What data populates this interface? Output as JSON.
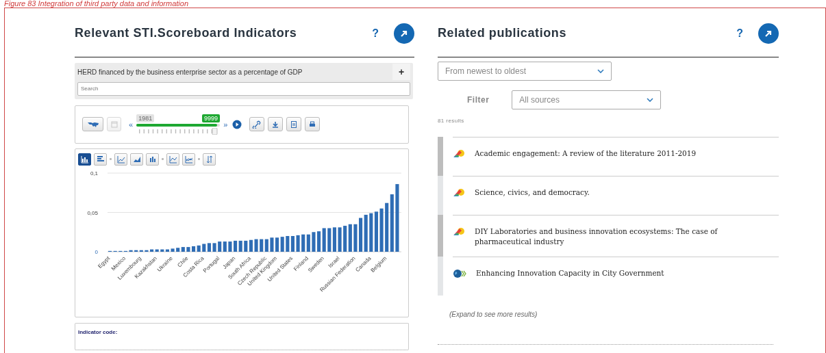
{
  "caption": "Figure 83 Integration of third party data and information",
  "indicators": {
    "title": "Relevant STI.Scoreboard Indicators",
    "help": "?",
    "selector": {
      "value": "HERD financed by the business enterprise sector as a percentage of GDP",
      "toggle": "+",
      "search_placeholder": "Search"
    },
    "timeline": {
      "buttons_left": [
        {
          "kind": "map",
          "disabled": false
        },
        {
          "kind": "calendar",
          "disabled": true
        }
      ],
      "prev": "«",
      "next": "»",
      "start": "1981",
      "end": "9999",
      "level": 0.97,
      "buttons_right": [
        {
          "kind": "link"
        },
        {
          "kind": "download"
        },
        {
          "kind": "document"
        },
        {
          "kind": "print"
        }
      ]
    },
    "chart_types": [
      {
        "kind": "column",
        "selected": true
      },
      {
        "kind": "bar",
        "selected": false
      },
      {
        "kind": "sep"
      },
      {
        "kind": "line",
        "selected": false
      },
      {
        "kind": "area",
        "selected": false
      },
      {
        "kind": "stacked",
        "selected": false
      },
      {
        "kind": "sep"
      },
      {
        "kind": "line-points",
        "selected": false
      },
      {
        "kind": "multi-line",
        "selected": false
      },
      {
        "kind": "sep"
      },
      {
        "kind": "sort",
        "selected": false
      }
    ],
    "chart_data": {
      "type": "bar",
      "ylim": [
        0,
        0.1
      ],
      "yticks": [
        {
          "value": 0,
          "label": "0"
        },
        {
          "value": 0.05,
          "label": "0,05"
        },
        {
          "value": 0.1,
          "label": "0,1"
        }
      ],
      "series": [
        {
          "color": "#2f6db5",
          "values": [
            0.001,
            0.001,
            0.001,
            0.001,
            0.002,
            0.002,
            0.002,
            0.002,
            0.003,
            0.003,
            0.003,
            0.003,
            0.004,
            0.005,
            0.006,
            0.006,
            0.007,
            0.008,
            0.01,
            0.011,
            0.011,
            0.013,
            0.013,
            0.013,
            0.014,
            0.014,
            0.014,
            0.015,
            0.016,
            0.016,
            0.016,
            0.018,
            0.018,
            0.019,
            0.02,
            0.02,
            0.021,
            0.022,
            0.022,
            0.025,
            0.026,
            0.03,
            0.03,
            0.031,
            0.031,
            0.033,
            0.035,
            0.035,
            0.043,
            0.047,
            0.049,
            0.051,
            0.055,
            0.062,
            0.073,
            0.086
          ]
        }
      ],
      "categories": [
        "Egypt",
        null,
        null,
        "Mexico",
        null,
        null,
        "Luxembourg",
        null,
        null,
        "Kazakhstan",
        null,
        null,
        "Ukraine",
        null,
        null,
        "Chile",
        null,
        null,
        "Costa Rica",
        null,
        null,
        "Portugal",
        null,
        null,
        "Japan",
        null,
        null,
        "South Africa",
        null,
        null,
        "Czech Republic",
        null,
        "United Kingdom",
        null,
        null,
        "United States",
        null,
        null,
        "Finland",
        null,
        null,
        "Sweden",
        null,
        null,
        "Israel",
        null,
        null,
        "Russian Federation",
        null,
        null,
        "Canada",
        null,
        null,
        "Belgium",
        null,
        null
      ]
    },
    "code_label": "Indicator code:"
  },
  "publications": {
    "title": "Related publications",
    "help": "?",
    "sort": "From newest to oldest",
    "filter_label": "Filter",
    "filter": "All sources",
    "count": "81 results",
    "items": [
      {
        "kind": "fan",
        "title": "Academic engagement: A review of the literature 2011-2019"
      },
      {
        "kind": "fan",
        "title": "Science, civics, and democracy."
      },
      {
        "kind": "fan",
        "title": "DIY Laboratories and business innovation ecosystems: The case of pharmaceutical industry"
      },
      {
        "kind": "globe",
        "title": "Enhancing Innovation Capacity in City Government"
      }
    ],
    "more": "(Expand to see more results)"
  }
}
